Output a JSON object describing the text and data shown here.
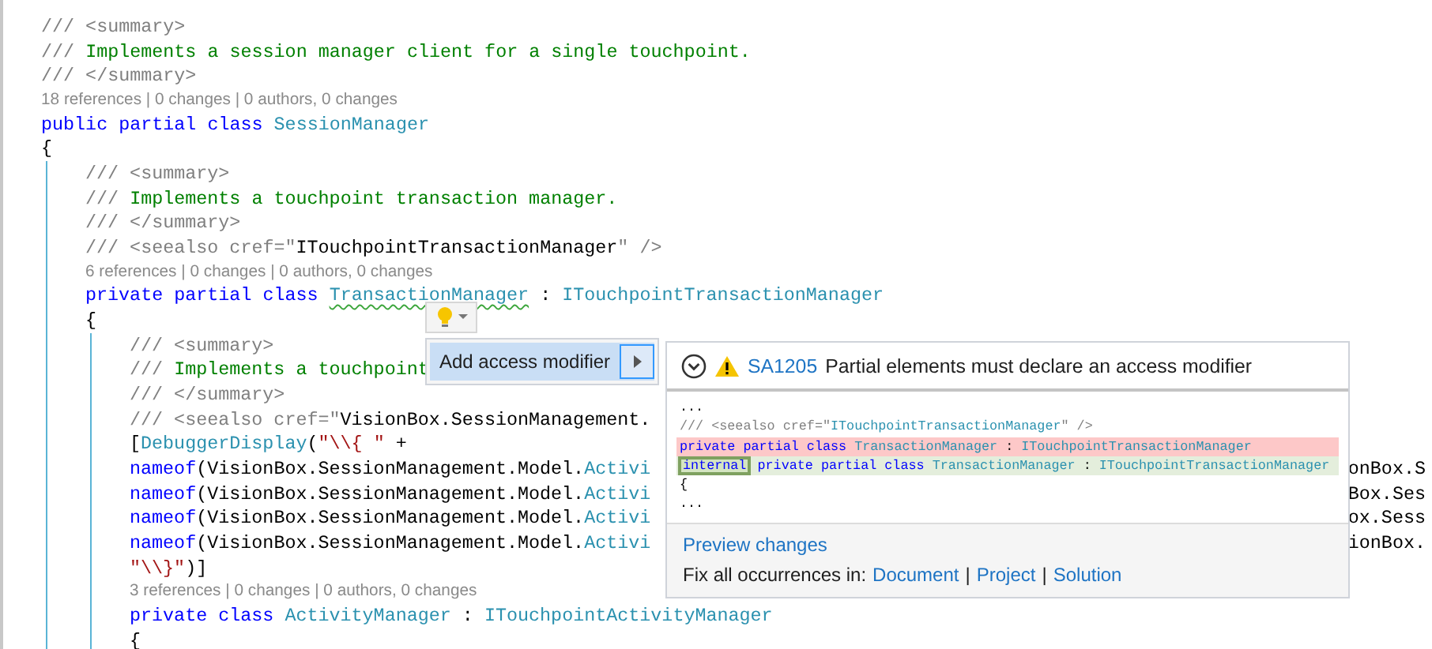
{
  "editor": {
    "lines": [
      {
        "kind": "code",
        "tokens": [
          {
            "text": "/// <summary>",
            "kind": "doc-tag"
          }
        ]
      },
      {
        "kind": "code",
        "tokens": [
          {
            "text": "/// ",
            "kind": "doc-tag"
          },
          {
            "text": "Implements a session manager client for a single touchpoint.",
            "kind": "comment"
          }
        ]
      },
      {
        "kind": "code",
        "tokens": [
          {
            "text": "/// </summary>",
            "kind": "doc-tag"
          }
        ]
      },
      {
        "kind": "lens",
        "text": "18 references | 0 changes | 0 authors, 0 changes"
      },
      {
        "kind": "code",
        "tokens": [
          {
            "text": "public partial class ",
            "kind": "keyword"
          },
          {
            "text": "SessionManager",
            "kind": "type"
          }
        ]
      },
      {
        "kind": "code",
        "tokens": [
          {
            "text": "{",
            "kind": "plain"
          }
        ],
        "children": [
          {
            "kind": "code",
            "tokens": [
              {
                "text": "/// <summary>",
                "kind": "doc-tag"
              }
            ]
          },
          {
            "kind": "code",
            "tokens": [
              {
                "text": "/// ",
                "kind": "doc-tag"
              },
              {
                "text": "Implements a touchpoint transaction manager.",
                "kind": "comment"
              }
            ]
          },
          {
            "kind": "code",
            "tokens": [
              {
                "text": "/// </summary>",
                "kind": "doc-tag"
              }
            ]
          },
          {
            "kind": "code",
            "tokens": [
              {
                "text": "/// <seealso cref=\"",
                "kind": "doc-tag"
              },
              {
                "text": "ITouchpointTransactionManager",
                "kind": "plain"
              },
              {
                "text": "\" />",
                "kind": "doc-tag"
              }
            ]
          },
          {
            "kind": "lens",
            "text": "6 references | 0 changes | 0 authors, 0 changes"
          },
          {
            "kind": "code",
            "tokens": [
              {
                "text": "private partial class ",
                "kind": "keyword"
              },
              {
                "text": "TransactionManager",
                "kind": "type-squiggle"
              },
              {
                "text": " : ",
                "kind": "plain"
              },
              {
                "text": "ITouchpointTransactionManager",
                "kind": "type"
              }
            ]
          },
          {
            "kind": "code",
            "tokens": [
              {
                "text": "{",
                "kind": "plain"
              }
            ],
            "children": [
              {
                "kind": "code",
                "tokens": [
                  {
                    "text": "/// <summary>",
                    "kind": "doc-tag"
                  }
                ]
              },
              {
                "kind": "code",
                "tokens": [
                  {
                    "text": "/// ",
                    "kind": "doc-tag"
                  },
                  {
                    "text": "Implements a touchpoint",
                    "kind": "comment"
                  }
                ]
              },
              {
                "kind": "code",
                "tokens": [
                  {
                    "text": "/// </summary>",
                    "kind": "doc-tag"
                  }
                ]
              },
              {
                "kind": "code",
                "tokens": [
                  {
                    "text": "/// <seealso cref=\"",
                    "kind": "doc-tag"
                  },
                  {
                    "text": "VisionBox.SessionManagement.",
                    "kind": "plain"
                  }
                ]
              },
              {
                "kind": "code",
                "tokens": [
                  {
                    "text": "[",
                    "kind": "plain"
                  },
                  {
                    "text": "DebuggerDisplay",
                    "kind": "type"
                  },
                  {
                    "text": "(",
                    "kind": "plain"
                  },
                  {
                    "text": "\"\\\\{ \"",
                    "kind": "string"
                  },
                  {
                    "text": " +",
                    "kind": "plain"
                  }
                ]
              },
              {
                "kind": "code",
                "tokens": [
                  {
                    "text": "nameof",
                    "kind": "keyword"
                  },
                  {
                    "text": "(VisionBox.SessionManagement.Model.",
                    "kind": "plain"
                  },
                  {
                    "text": "Activi",
                    "kind": "type"
                  }
                ],
                "tail": "onBox.S"
              },
              {
                "kind": "code",
                "tokens": [
                  {
                    "text": "nameof",
                    "kind": "keyword"
                  },
                  {
                    "text": "(VisionBox.SessionManagement.Model.",
                    "kind": "plain"
                  },
                  {
                    "text": "Activi",
                    "kind": "type"
                  }
                ],
                "tail": "Box.Ses"
              },
              {
                "kind": "code",
                "tokens": [
                  {
                    "text": "nameof",
                    "kind": "keyword"
                  },
                  {
                    "text": "(VisionBox.SessionManagement.Model.",
                    "kind": "plain"
                  },
                  {
                    "text": "Activi",
                    "kind": "type"
                  }
                ],
                "tail": "ox.Sess"
              },
              {
                "kind": "code",
                "tokens": [
                  {
                    "text": "nameof",
                    "kind": "keyword"
                  },
                  {
                    "text": "(VisionBox.SessionManagement.Model.",
                    "kind": "plain"
                  },
                  {
                    "text": "Activi",
                    "kind": "type"
                  }
                ],
                "tail": "ionBox."
              },
              {
                "kind": "code",
                "tokens": [
                  {
                    "text": "\"\\\\}\"",
                    "kind": "string"
                  },
                  {
                    "text": ")]",
                    "kind": "plain"
                  }
                ]
              },
              {
                "kind": "lens",
                "text": "3 references | 0 changes | 0 authors, 0 changes"
              },
              {
                "kind": "code",
                "tokens": [
                  {
                    "text": "private class ",
                    "kind": "keyword"
                  },
                  {
                    "text": "ActivityManager",
                    "kind": "type"
                  },
                  {
                    "text": " : ",
                    "kind": "plain"
                  },
                  {
                    "text": "ITouchpointActivityManager",
                    "kind": "type"
                  }
                ]
              },
              {
                "kind": "code",
                "tokens": [
                  {
                    "text": "{",
                    "kind": "plain"
                  }
                ]
              }
            ]
          }
        ]
      }
    ]
  },
  "quick_actions": {
    "menu_items": [
      {
        "label": "Add access modifier",
        "selected": true
      }
    ],
    "preview": {
      "rule_id": "SA1205",
      "message": "Partial elements must declare an access modifier",
      "lines": [
        {
          "kind": "context",
          "tokens": [
            {
              "text": "...",
              "kind": "plain"
            }
          ]
        },
        {
          "kind": "context",
          "tokens": [
            {
              "text": "/// <seealso cref=\"",
              "kind": "doc-tag"
            },
            {
              "text": "ITouchpointTransactionManager",
              "kind": "type"
            },
            {
              "text": "\" />",
              "kind": "doc-tag"
            }
          ]
        },
        {
          "kind": "removed",
          "tokens": [
            {
              "text": "private partial class ",
              "kind": "keyword"
            },
            {
              "text": "TransactionManager",
              "kind": "type"
            },
            {
              "text": " : ",
              "kind": "plain"
            },
            {
              "text": "ITouchpointTransactionManager",
              "kind": "type"
            }
          ]
        },
        {
          "kind": "added",
          "tokens": [
            {
              "text": "internal",
              "kind": "keyword-inserted"
            },
            {
              "text": " private partial class ",
              "kind": "keyword"
            },
            {
              "text": "TransactionManager",
              "kind": "type"
            },
            {
              "text": " : ",
              "kind": "plain"
            },
            {
              "text": "ITouchpointTransactionManager",
              "kind": "type"
            }
          ]
        },
        {
          "kind": "context",
          "tokens": [
            {
              "text": "{",
              "kind": "plain"
            }
          ]
        },
        {
          "kind": "context",
          "tokens": [
            {
              "text": "...",
              "kind": "plain"
            }
          ]
        }
      ],
      "preview_link": "Preview changes",
      "fix_all_label": "Fix all occurrences in:",
      "fix_all_scopes": [
        "Document",
        "Project",
        "Solution"
      ],
      "separator": "|"
    }
  }
}
